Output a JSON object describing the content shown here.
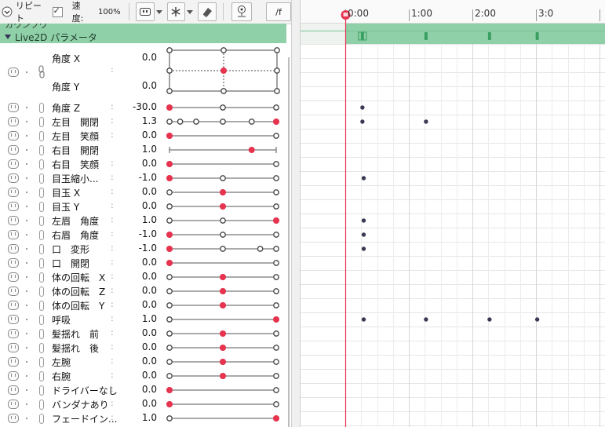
{
  "toolbar": {
    "repeat_label": "リピート",
    "repeat_checked": true,
    "speed_label": "速度:",
    "speed_value": "100%",
    "fps_label": "/f"
  },
  "groups": {
    "prev_label": "カウンフウ",
    "live2d_label": "Live2D パラメータ"
  },
  "xy_param": {
    "x_name": "角度 X",
    "x_value": "0.0",
    "y_name": "角度 Y",
    "y_value": "0.0"
  },
  "params": [
    {
      "name": "角度 Z",
      "value": "-30.0",
      "colon": ":",
      "level": 0.0,
      "keys": [
        0,
        0.5,
        1
      ]
    },
    {
      "name": "左目　開閉",
      "value": "1.3",
      "colon": ":",
      "level": 1.0,
      "keys": [
        0,
        0.1,
        0.25,
        0.5,
        0.77,
        1
      ]
    },
    {
      "name": "左目　笑顔",
      "value": "0.0",
      "colon": ":",
      "level": 0.0,
      "keys": [
        0,
        1
      ]
    },
    {
      "name": "右目　開閉",
      "value": "1.0",
      "colon": "",
      "level": 0.77,
      "keys": [],
      "line_only": true
    },
    {
      "name": "右目　笑顔",
      "value": "0.0",
      "colon": ":",
      "level": 0.0,
      "keys": [
        0,
        1
      ]
    },
    {
      "name": "目玉縮小...",
      "value": "-1.0",
      "colon": ":",
      "level": 0.0,
      "keys": [
        0,
        0.5,
        1
      ]
    },
    {
      "name": "目玉 X",
      "value": "0.0",
      "colon": ":",
      "level": 0.5,
      "keys": [
        0,
        0.5,
        1
      ]
    },
    {
      "name": "目玉 Y",
      "value": "0.0",
      "colon": ":",
      "level": 0.5,
      "keys": [
        0,
        0.5,
        1
      ]
    },
    {
      "name": "左眉　角度",
      "value": "1.0",
      "colon": ":",
      "level": 1.0,
      "keys": [
        0,
        0.5,
        1
      ]
    },
    {
      "name": "右眉　角度",
      "value": "-1.0",
      "colon": ":",
      "level": 0.0,
      "keys": [
        0,
        0.5,
        1
      ]
    },
    {
      "name": "口　変形",
      "value": "-1.0",
      "colon": ":",
      "level": 0.0,
      "keys": [
        0,
        0.5,
        0.85,
        1
      ]
    },
    {
      "name": "口　開閉",
      "value": "0.0",
      "colon": ":",
      "level": 0.0,
      "keys": [
        0,
        1
      ]
    },
    {
      "name": "体の回転　X",
      "value": "0.0",
      "colon": ":",
      "level": 0.5,
      "keys": [
        0,
        0.5,
        1
      ]
    },
    {
      "name": "体の回転　Z",
      "value": "0.0",
      "colon": ":",
      "level": 0.5,
      "keys": [
        0,
        0.5,
        1
      ]
    },
    {
      "name": "体の回転　Y",
      "value": "0.0",
      "colon": ":",
      "level": 0.5,
      "keys": [
        0,
        0.5,
        1
      ]
    },
    {
      "name": "呼吸",
      "value": "1.0",
      "colon": ":",
      "level": 1.0,
      "keys": [
        0,
        1
      ]
    },
    {
      "name": "髪揺れ　前",
      "value": "0.0",
      "colon": ":",
      "level": 0.5,
      "keys": [
        0,
        0.5,
        1
      ]
    },
    {
      "name": "髪揺れ　後",
      "value": "0.0",
      "colon": ":",
      "level": 0.5,
      "keys": [
        0,
        0.5,
        1
      ]
    },
    {
      "name": "左腕",
      "value": "0.0",
      "colon": ":",
      "level": 0.5,
      "keys": [
        0,
        0.5,
        1
      ]
    },
    {
      "name": "右腕",
      "value": "0.0",
      "colon": ":",
      "level": 0.5,
      "keys": [
        0,
        0.5,
        1
      ]
    },
    {
      "name": "ドライバーなし",
      "value": "0.0",
      "colon": ":",
      "level": 0.0,
      "keys": [
        0,
        1
      ]
    },
    {
      "name": "バンダナあり",
      "value": "0.0",
      "colon": ":",
      "level": 0.0,
      "keys": [
        0,
        1
      ]
    },
    {
      "name": "フェードイン...",
      "value": "1.0",
      "colon": ":",
      "level": 1.0,
      "keys": [
        0,
        1
      ]
    }
  ],
  "timeline": {
    "tick_labels": [
      "0:00",
      "1:00",
      "2:00",
      "3:0"
    ],
    "accent_color": "#e8334f",
    "group_color": "#8fd0a8",
    "group_key_times": [
      0.27,
      1.27,
      2.27,
      3.02
    ],
    "keyframes": [
      {
        "row": 0,
        "times": [
          0.27
        ]
      },
      {
        "row": 1,
        "times": [
          0.27,
          1.27
        ]
      },
      {
        "row": 5,
        "times": [
          0.29
        ]
      },
      {
        "row": 8,
        "times": [
          0.29
        ]
      },
      {
        "row": 9,
        "times": [
          0.29
        ]
      },
      {
        "row": 10,
        "times": [
          0.29
        ]
      },
      {
        "row": 15,
        "times": [
          0.29,
          1.27,
          2.27,
          3.02
        ]
      }
    ]
  }
}
